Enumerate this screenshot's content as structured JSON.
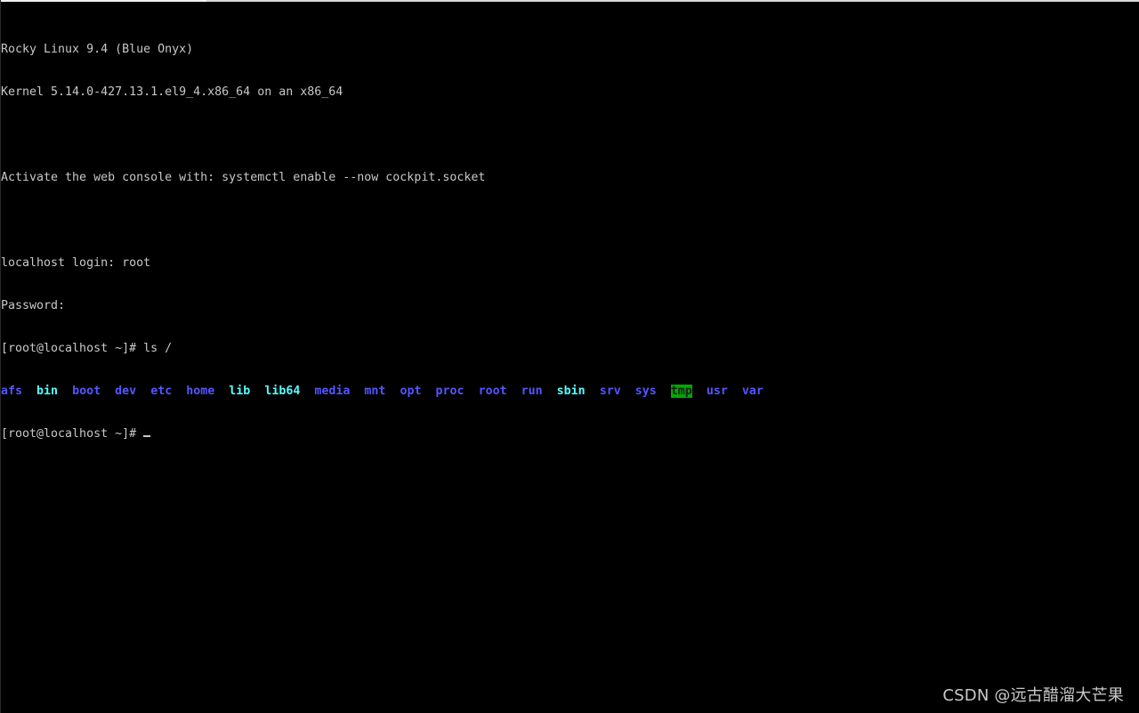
{
  "terminal": {
    "lines": [
      "Rocky Linux 9.4 (Blue Onyx)",
      "Kernel 5.14.0-427.13.1.el9_4.x86_64 on an x86_64",
      "",
      "Activate the web console with: systemctl enable --now cockpit.socket",
      "",
      "localhost login: root",
      "Password:",
      "[root@localhost ~]# ls /"
    ],
    "ls_output": [
      {
        "name": "afs",
        "color": "#5555ff"
      },
      {
        "name": "bin",
        "color": "#55ffff"
      },
      {
        "name": "boot",
        "color": "#5555ff"
      },
      {
        "name": "dev",
        "color": "#5555ff"
      },
      {
        "name": "etc",
        "color": "#5555ff"
      },
      {
        "name": "home",
        "color": "#5555ff"
      },
      {
        "name": "lib",
        "color": "#55ffff"
      },
      {
        "name": "lib64",
        "color": "#55ffff"
      },
      {
        "name": "media",
        "color": "#5555ff"
      },
      {
        "name": "mnt",
        "color": "#5555ff"
      },
      {
        "name": "opt",
        "color": "#5555ff"
      },
      {
        "name": "proc",
        "color": "#5555ff"
      },
      {
        "name": "root",
        "color": "#5555ff"
      },
      {
        "name": "run",
        "color": "#5555ff"
      },
      {
        "name": "sbin",
        "color": "#55ffff"
      },
      {
        "name": "srv",
        "color": "#5555ff"
      },
      {
        "name": "sys",
        "color": "#5555ff"
      },
      {
        "name": "tmp",
        "color": "#1a1a1a",
        "background": "#00a800"
      },
      {
        "name": "usr",
        "color": "#5555ff"
      },
      {
        "name": "var",
        "color": "#5555ff"
      }
    ],
    "prompt": "[root@localhost ~]# "
  },
  "watermark": "CSDN @远古醋溜大芒果",
  "colors": {
    "background": "#000000",
    "text": "#c8c8c8",
    "directory": "#5555ff",
    "symlink": "#55ffff",
    "sticky_dir_bg": "#00a800"
  }
}
